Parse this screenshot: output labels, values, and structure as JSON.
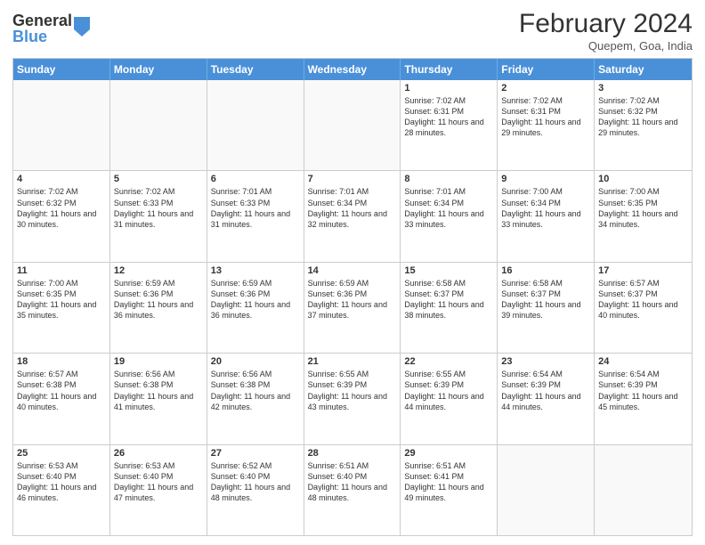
{
  "header": {
    "logo_general": "General",
    "logo_blue": "Blue",
    "month_title": "February 2024",
    "subtitle": "Quepem, Goa, India"
  },
  "days_of_week": [
    "Sunday",
    "Monday",
    "Tuesday",
    "Wednesday",
    "Thursday",
    "Friday",
    "Saturday"
  ],
  "weeks": [
    [
      {
        "day": "",
        "info": "",
        "empty": true
      },
      {
        "day": "",
        "info": "",
        "empty": true
      },
      {
        "day": "",
        "info": "",
        "empty": true
      },
      {
        "day": "",
        "info": "",
        "empty": true
      },
      {
        "day": "1",
        "info": "Sunrise: 7:02 AM\nSunset: 6:31 PM\nDaylight: 11 hours and 28 minutes."
      },
      {
        "day": "2",
        "info": "Sunrise: 7:02 AM\nSunset: 6:31 PM\nDaylight: 11 hours and 29 minutes."
      },
      {
        "day": "3",
        "info": "Sunrise: 7:02 AM\nSunset: 6:32 PM\nDaylight: 11 hours and 29 minutes."
      }
    ],
    [
      {
        "day": "4",
        "info": "Sunrise: 7:02 AM\nSunset: 6:32 PM\nDaylight: 11 hours and 30 minutes."
      },
      {
        "day": "5",
        "info": "Sunrise: 7:02 AM\nSunset: 6:33 PM\nDaylight: 11 hours and 31 minutes."
      },
      {
        "day": "6",
        "info": "Sunrise: 7:01 AM\nSunset: 6:33 PM\nDaylight: 11 hours and 31 minutes."
      },
      {
        "day": "7",
        "info": "Sunrise: 7:01 AM\nSunset: 6:34 PM\nDaylight: 11 hours and 32 minutes."
      },
      {
        "day": "8",
        "info": "Sunrise: 7:01 AM\nSunset: 6:34 PM\nDaylight: 11 hours and 33 minutes."
      },
      {
        "day": "9",
        "info": "Sunrise: 7:00 AM\nSunset: 6:34 PM\nDaylight: 11 hours and 33 minutes."
      },
      {
        "day": "10",
        "info": "Sunrise: 7:00 AM\nSunset: 6:35 PM\nDaylight: 11 hours and 34 minutes."
      }
    ],
    [
      {
        "day": "11",
        "info": "Sunrise: 7:00 AM\nSunset: 6:35 PM\nDaylight: 11 hours and 35 minutes."
      },
      {
        "day": "12",
        "info": "Sunrise: 6:59 AM\nSunset: 6:36 PM\nDaylight: 11 hours and 36 minutes."
      },
      {
        "day": "13",
        "info": "Sunrise: 6:59 AM\nSunset: 6:36 PM\nDaylight: 11 hours and 36 minutes."
      },
      {
        "day": "14",
        "info": "Sunrise: 6:59 AM\nSunset: 6:36 PM\nDaylight: 11 hours and 37 minutes."
      },
      {
        "day": "15",
        "info": "Sunrise: 6:58 AM\nSunset: 6:37 PM\nDaylight: 11 hours and 38 minutes."
      },
      {
        "day": "16",
        "info": "Sunrise: 6:58 AM\nSunset: 6:37 PM\nDaylight: 11 hours and 39 minutes."
      },
      {
        "day": "17",
        "info": "Sunrise: 6:57 AM\nSunset: 6:37 PM\nDaylight: 11 hours and 40 minutes."
      }
    ],
    [
      {
        "day": "18",
        "info": "Sunrise: 6:57 AM\nSunset: 6:38 PM\nDaylight: 11 hours and 40 minutes."
      },
      {
        "day": "19",
        "info": "Sunrise: 6:56 AM\nSunset: 6:38 PM\nDaylight: 11 hours and 41 minutes."
      },
      {
        "day": "20",
        "info": "Sunrise: 6:56 AM\nSunset: 6:38 PM\nDaylight: 11 hours and 42 minutes."
      },
      {
        "day": "21",
        "info": "Sunrise: 6:55 AM\nSunset: 6:39 PM\nDaylight: 11 hours and 43 minutes."
      },
      {
        "day": "22",
        "info": "Sunrise: 6:55 AM\nSunset: 6:39 PM\nDaylight: 11 hours and 44 minutes."
      },
      {
        "day": "23",
        "info": "Sunrise: 6:54 AM\nSunset: 6:39 PM\nDaylight: 11 hours and 44 minutes."
      },
      {
        "day": "24",
        "info": "Sunrise: 6:54 AM\nSunset: 6:39 PM\nDaylight: 11 hours and 45 minutes."
      }
    ],
    [
      {
        "day": "25",
        "info": "Sunrise: 6:53 AM\nSunset: 6:40 PM\nDaylight: 11 hours and 46 minutes."
      },
      {
        "day": "26",
        "info": "Sunrise: 6:53 AM\nSunset: 6:40 PM\nDaylight: 11 hours and 47 minutes."
      },
      {
        "day": "27",
        "info": "Sunrise: 6:52 AM\nSunset: 6:40 PM\nDaylight: 11 hours and 48 minutes."
      },
      {
        "day": "28",
        "info": "Sunrise: 6:51 AM\nSunset: 6:40 PM\nDaylight: 11 hours and 48 minutes."
      },
      {
        "day": "29",
        "info": "Sunrise: 6:51 AM\nSunset: 6:41 PM\nDaylight: 11 hours and 49 minutes."
      },
      {
        "day": "",
        "info": "",
        "empty": true
      },
      {
        "day": "",
        "info": "",
        "empty": true
      }
    ]
  ]
}
